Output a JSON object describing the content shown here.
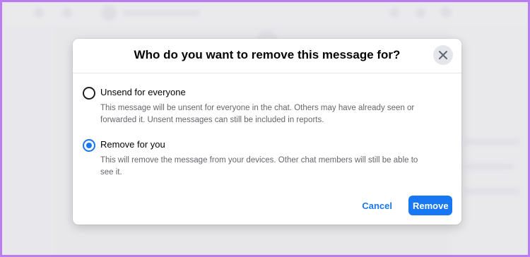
{
  "dialog": {
    "title": "Who do you want to remove this message for?",
    "close_icon": "close-icon",
    "options": [
      {
        "label": "Unsend for everyone",
        "description": "This message will be unsent for everyone in the chat. Others may have already seen or forwarded it. Unsent messages can still be included in reports.",
        "selected": false
      },
      {
        "label": "Remove for you",
        "description": "This will remove the message from your devices. Other chat members will still be able to see it.",
        "selected": true
      }
    ],
    "cancel_label": "Cancel",
    "remove_label": "Remove"
  },
  "colors": {
    "accent": "#1877f2",
    "frame_border": "#b97cf2",
    "secondary_text": "#65676b"
  }
}
